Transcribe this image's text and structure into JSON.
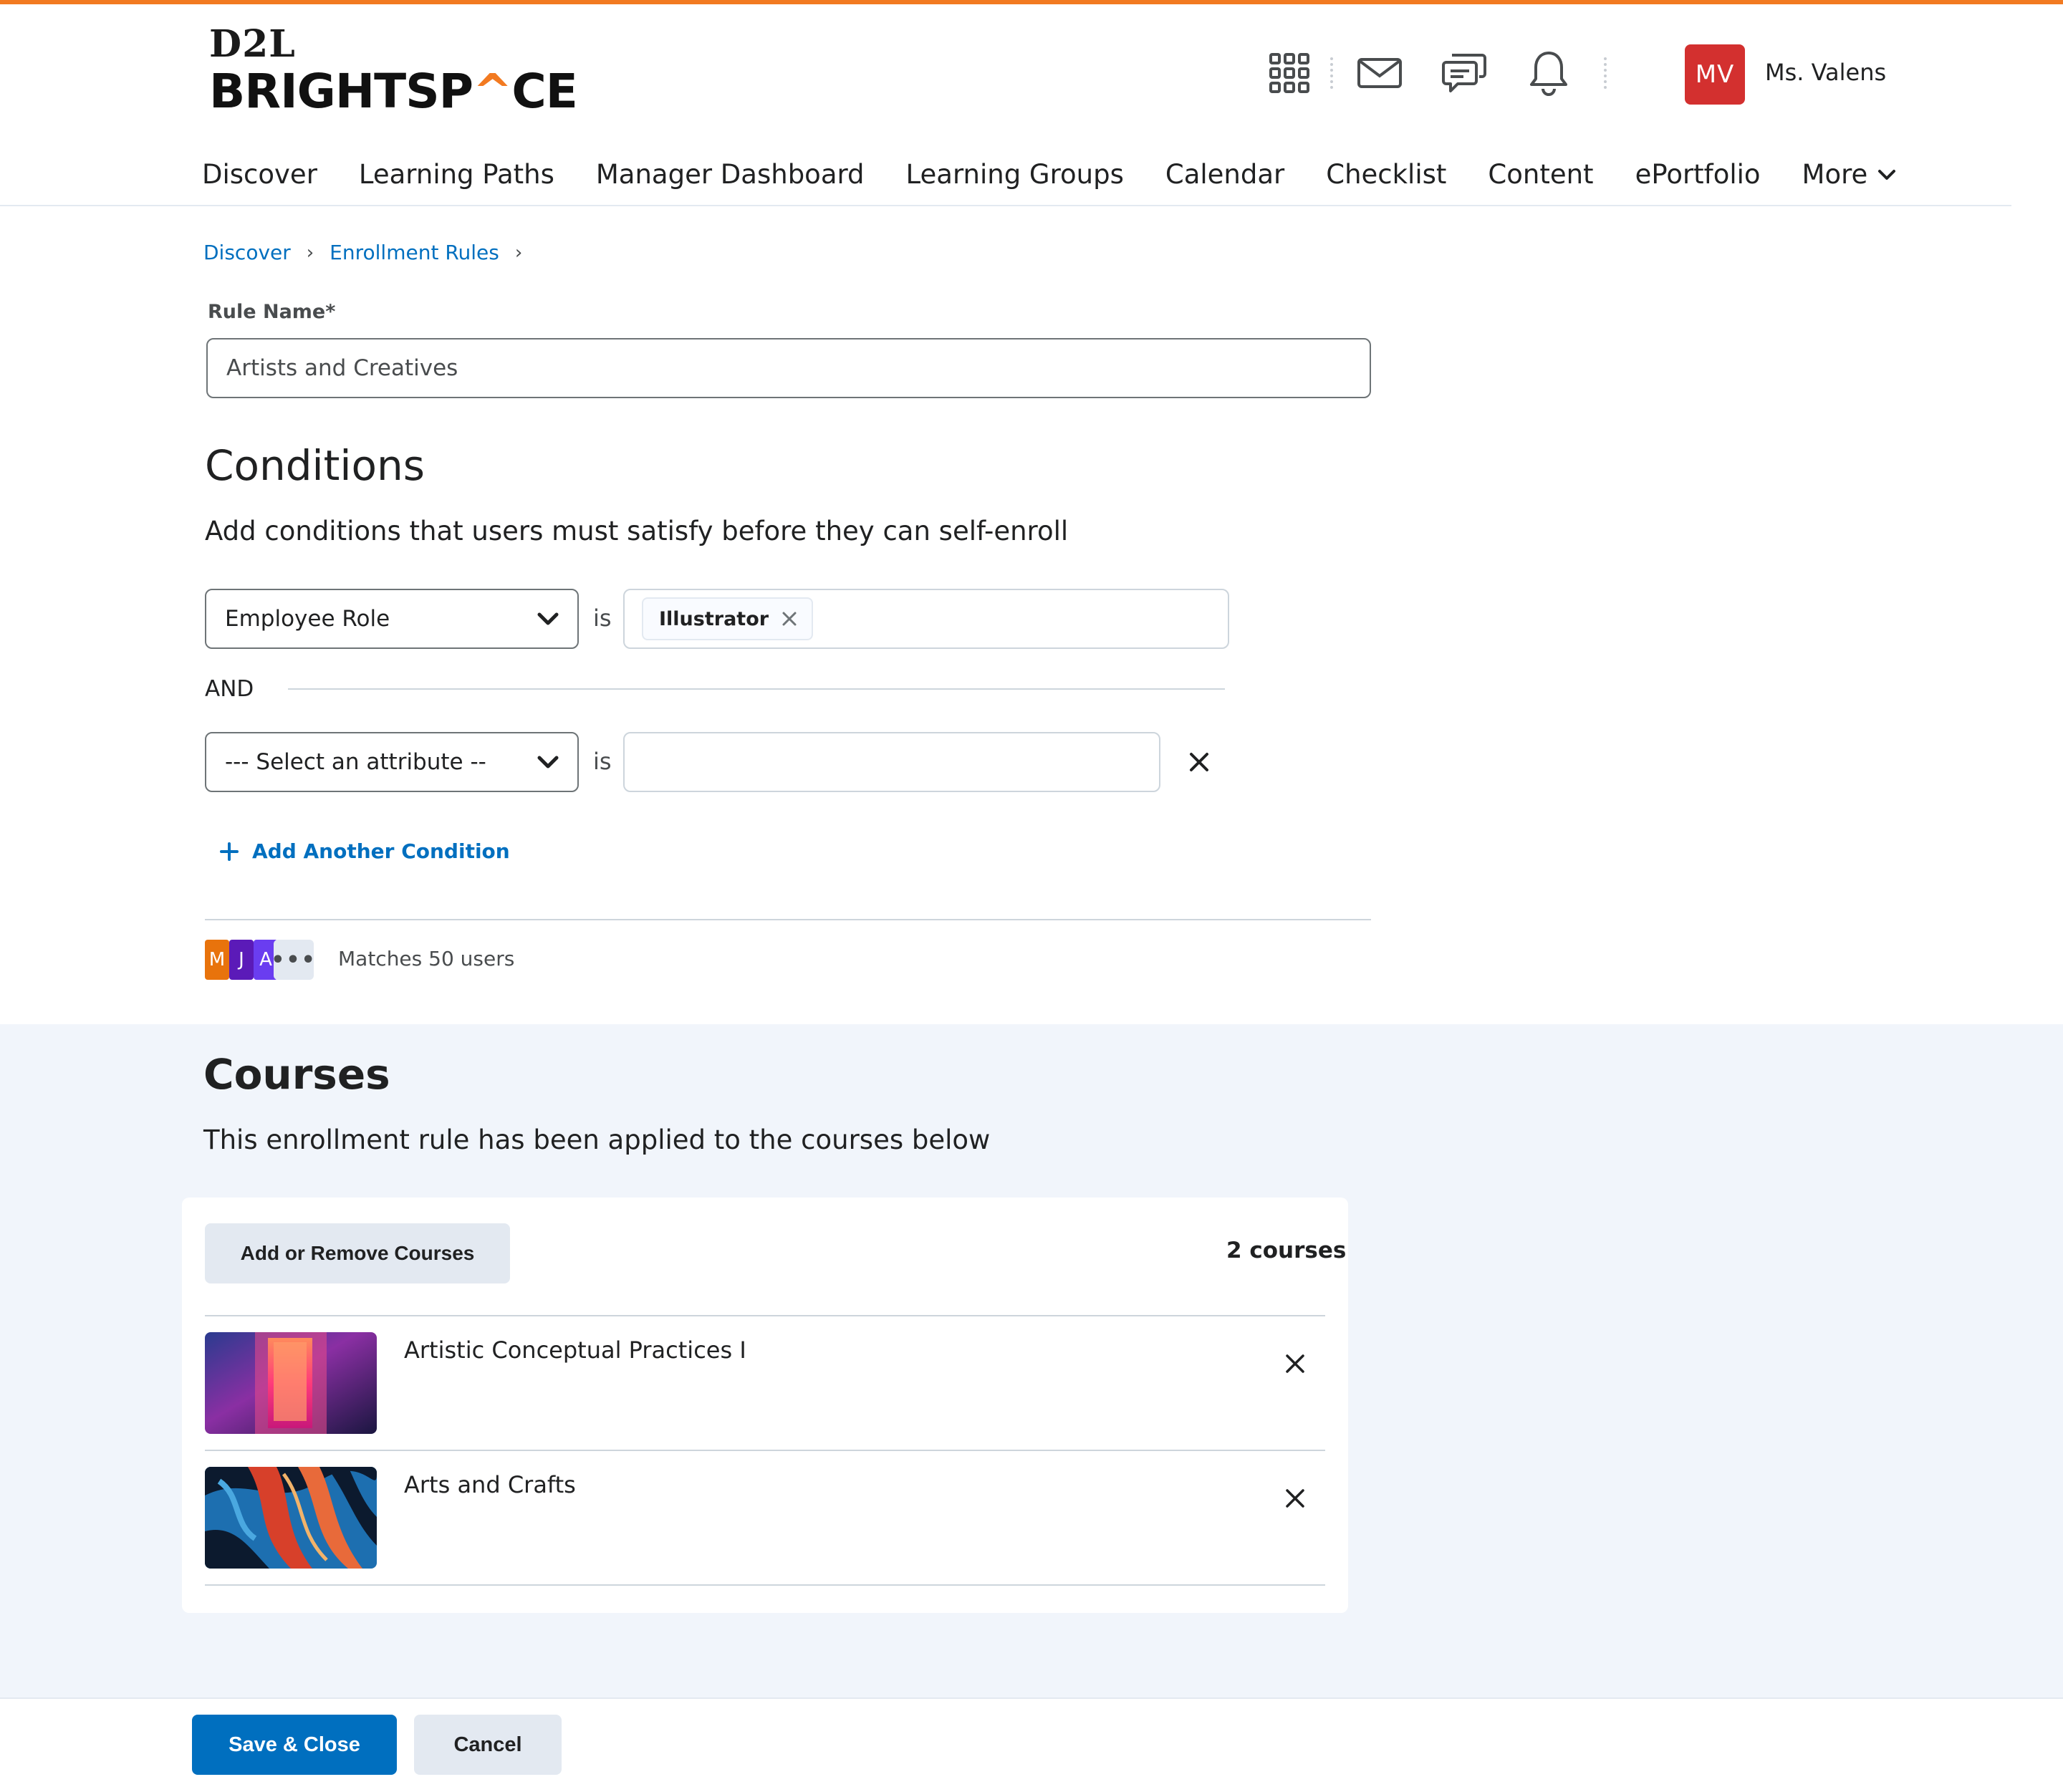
{
  "brand": {
    "line1": "D2L",
    "line2_a": "BRIGHTSP",
    "line2_b": "^",
    "line2_c": "CE",
    "accent_color": "#f27a21"
  },
  "header": {
    "icons": [
      "grid-icon",
      "mail-icon",
      "chat-icon",
      "bell-icon"
    ],
    "avatar_initials": "MV",
    "avatar_color": "#d3302f",
    "user_name": "Ms. Valens"
  },
  "nav": {
    "items": [
      "Discover",
      "Learning Paths",
      "Manager Dashboard",
      "Learning Groups",
      "Calendar",
      "Checklist",
      "Content",
      "ePortfolio"
    ],
    "more_label": "More"
  },
  "breadcrumb": {
    "items": [
      "Discover",
      "Enrollment Rules"
    ]
  },
  "rule": {
    "label": "Rule Name*",
    "value": "Artists and Creatives"
  },
  "conditions": {
    "heading": "Conditions",
    "description": "Add conditions that users must satisfy before they can self-enroll",
    "rows": [
      {
        "attribute": "Employee Role",
        "operator": "is",
        "values": [
          "Illustrator"
        ]
      },
      {
        "attribute": "--- Select an attribute --",
        "operator": "is",
        "values": []
      }
    ],
    "joiner": "AND",
    "add_label": "Add Another Condition"
  },
  "matches": {
    "avatars": [
      {
        "initial": "M",
        "color": "#e8730c"
      },
      {
        "initial": "J",
        "color": "#5b1ab8"
      },
      {
        "initial": "A",
        "color": "#6a3df0"
      }
    ],
    "more": "•••",
    "text": "Matches 50 users"
  },
  "courses": {
    "heading": "Courses",
    "description": "This enrollment rule has been applied to the courses below",
    "add_remove_label": "Add or Remove Courses",
    "count_label": "2 courses",
    "items": [
      {
        "title": "Artistic Conceptual Practices I"
      },
      {
        "title": "Arts and Crafts"
      }
    ]
  },
  "footer": {
    "save_label": "Save & Close",
    "cancel_label": "Cancel"
  },
  "colors": {
    "link": "#006fbf",
    "primary": "#006fbf",
    "section_bg": "#f1f5fb"
  }
}
